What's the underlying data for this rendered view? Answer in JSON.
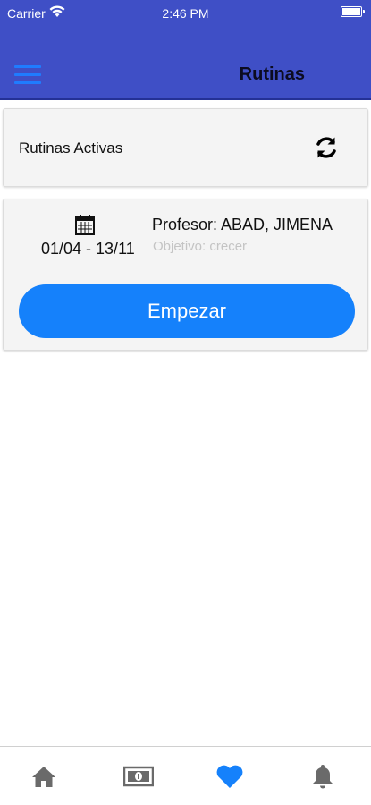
{
  "status_bar": {
    "carrier": "Carrier",
    "time": "2:46 PM"
  },
  "header": {
    "title": "Rutinas",
    "background_color": "#3f4fc6",
    "menu_icon": "hamburger-menu-icon"
  },
  "section": {
    "title": "Rutinas Activas",
    "action_icon": "refresh-icon"
  },
  "routine_card": {
    "date_icon": "calendar-icon",
    "date_range": "01/04 - 13/11",
    "teacher": "Profesor: ABAD, JIMENA",
    "objective": "Objetivo: crecer",
    "button_label": "Empezar",
    "button_color": "#1581fb"
  },
  "tab_bar": {
    "items": [
      {
        "icon": "home-icon",
        "active": false
      },
      {
        "icon": "money-icon",
        "active": false
      },
      {
        "icon": "heart-icon",
        "active": true
      },
      {
        "icon": "bell-icon",
        "active": false
      }
    ],
    "active_color": "#1581fb",
    "inactive_color": "#6a6a6a"
  }
}
